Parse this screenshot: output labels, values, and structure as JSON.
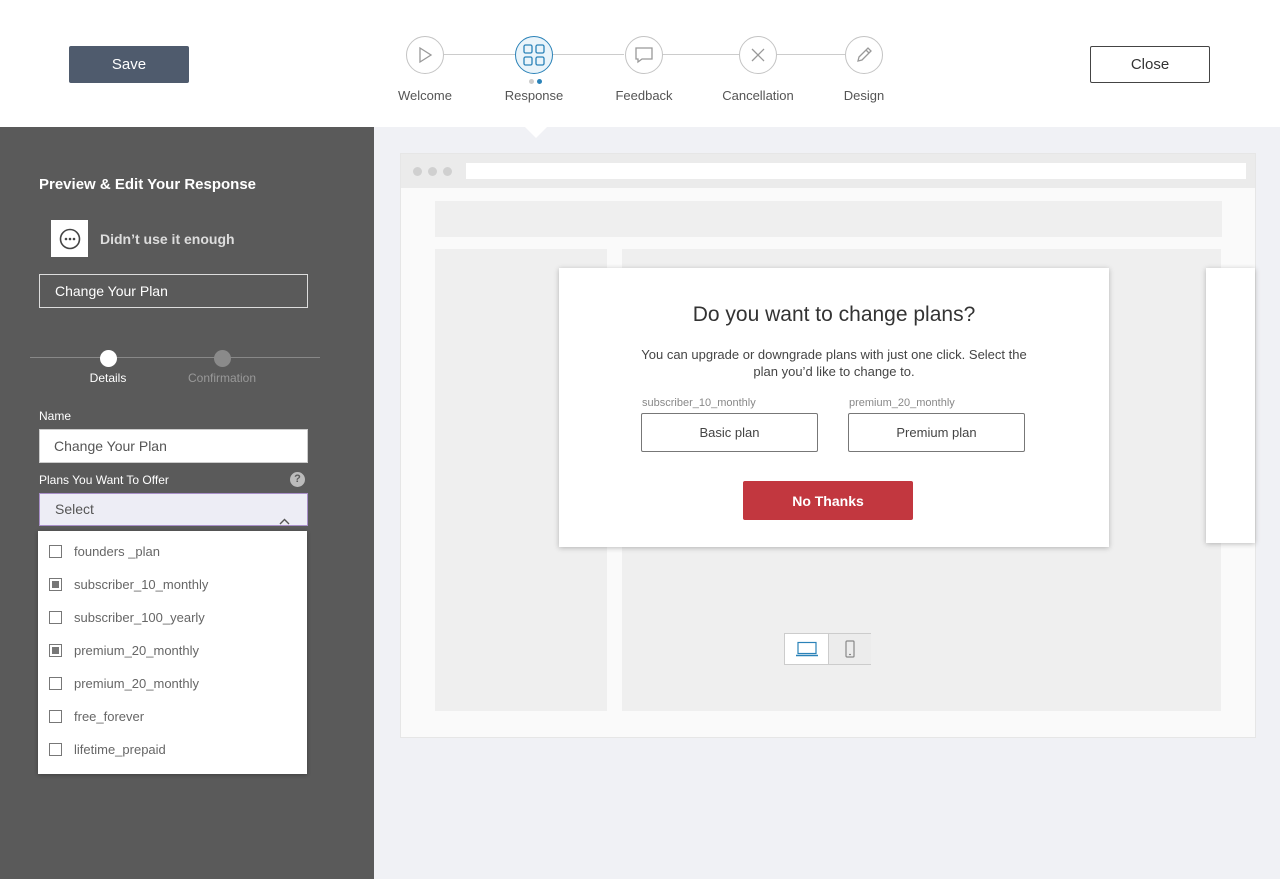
{
  "header": {
    "save_label": "Save",
    "close_label": "Close",
    "steps": [
      {
        "label": "Welcome",
        "icon": "play-icon",
        "active": false
      },
      {
        "label": "Response",
        "icon": "grid-icon",
        "active": true
      },
      {
        "label": "Feedback",
        "icon": "chat-bubble-icon",
        "active": false
      },
      {
        "label": "Cancellation",
        "icon": "x-circle-icon",
        "active": false
      },
      {
        "label": "Design",
        "icon": "pencil-icon",
        "active": false
      }
    ],
    "accent_color": "#2a82b8"
  },
  "sidebar": {
    "title": "Preview & Edit Your Response",
    "reason": {
      "icon": "ellipsis-circle-icon",
      "label": "Didn’t use it enough"
    },
    "response_title": "Change Your Plan",
    "substeps": [
      {
        "label": "Details",
        "active": true
      },
      {
        "label": "Confirmation",
        "active": false
      }
    ],
    "name_label": "Name",
    "name_value": "Change Your Plan",
    "plans_label": "Plans You Want To Offer",
    "help_icon": "?",
    "select_placeholder": "Select",
    "plan_options": [
      {
        "label": "founders _plan",
        "checked": false
      },
      {
        "label": "subscriber_10_monthly",
        "checked": true
      },
      {
        "label": "subscriber_100_yearly",
        "checked": false
      },
      {
        "label": "premium_20_monthly",
        "checked": true
      },
      {
        "label": "premium_20_monthly",
        "checked": false
      },
      {
        "label": "free_forever",
        "checked": false
      },
      {
        "label": "lifetime_prepaid",
        "checked": false
      }
    ]
  },
  "preview": {
    "modal": {
      "title": "Do you want to change plans?",
      "description": "You can upgrade or downgrade plans with just one click. Select the plan you’d like to change to.",
      "plans": [
        {
          "id": "subscriber_10_monthly",
          "button": "Basic plan"
        },
        {
          "id": "premium_20_monthly",
          "button": "Premium plan"
        }
      ],
      "decline_label": "No Thanks",
      "decline_color": "#c2373f"
    },
    "device_toggle": {
      "desktop_icon": "laptop-icon",
      "mobile_icon": "phone-icon"
    }
  }
}
